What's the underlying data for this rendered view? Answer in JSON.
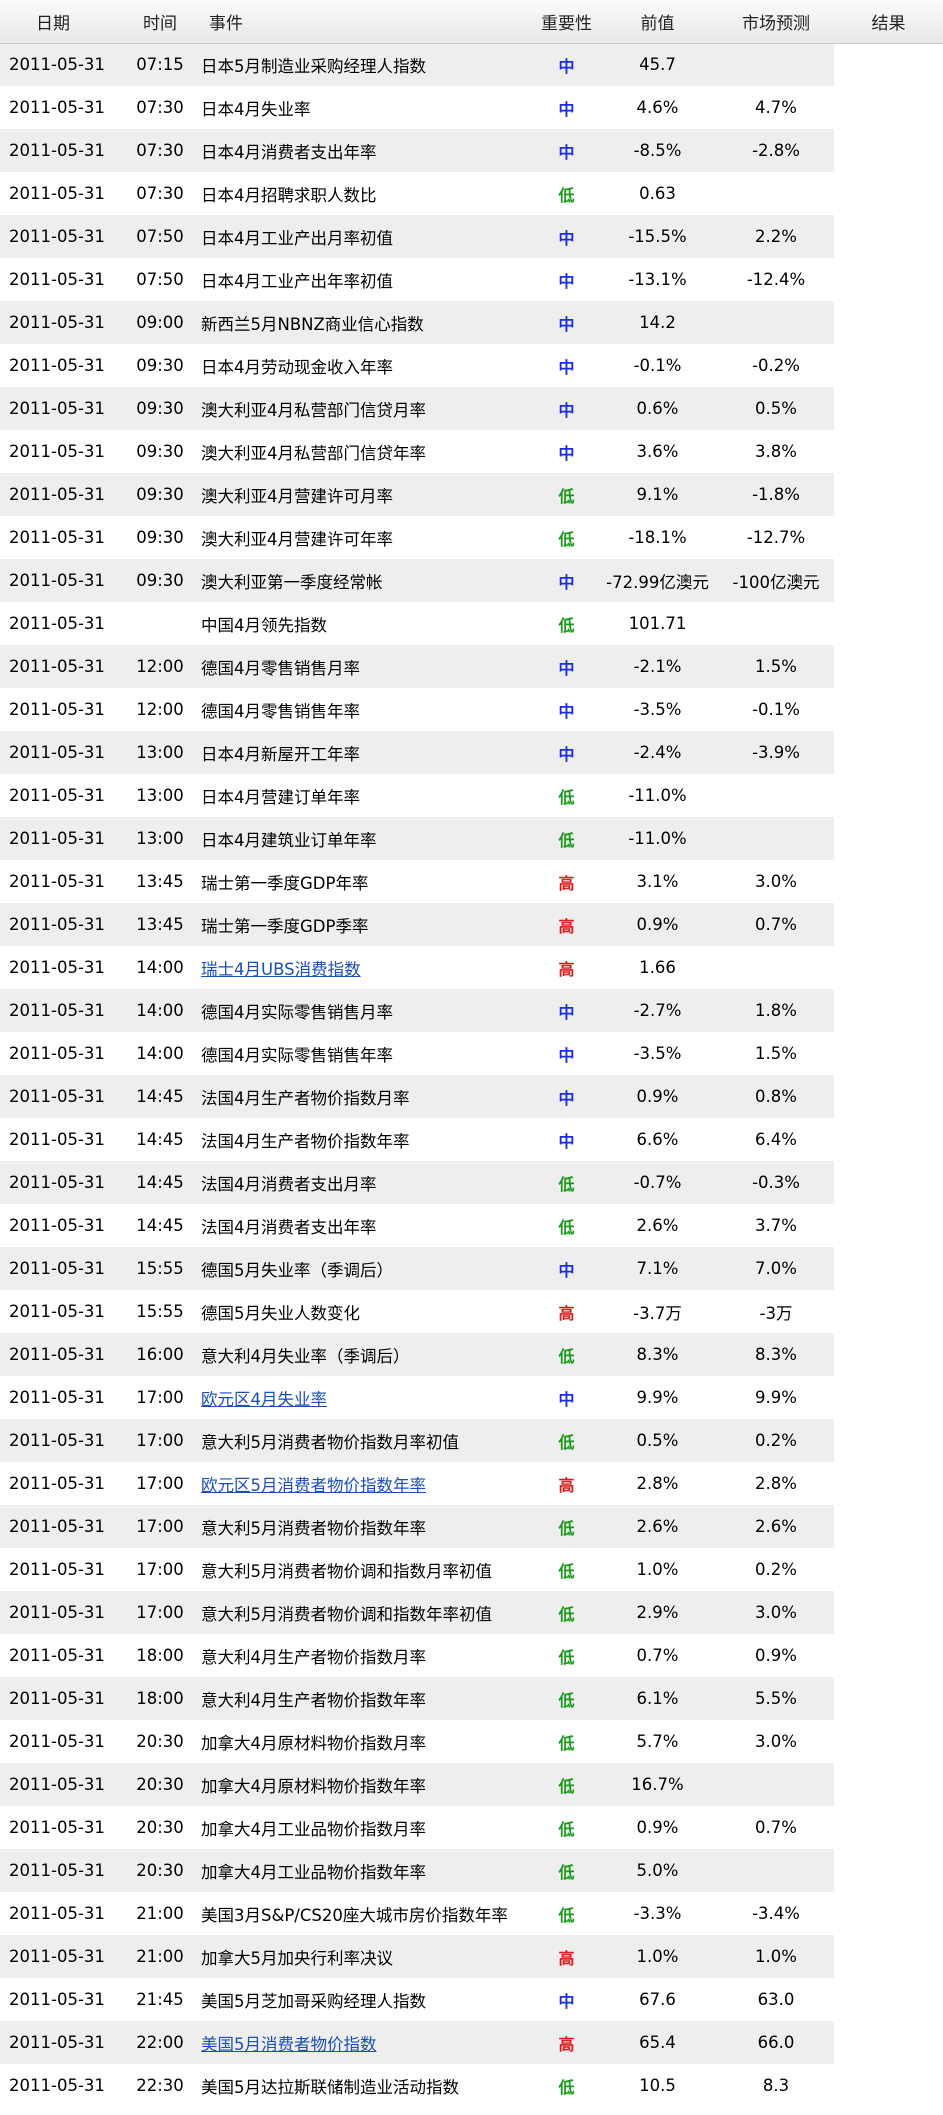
{
  "headers": {
    "date": "日期",
    "time": "时间",
    "event": "事件",
    "importance": "重要性",
    "previous": "前值",
    "forecast": "市场预测",
    "result": "结果"
  },
  "importance_colors": {
    "中": "#1a2ee0",
    "低": "#1a9a1a",
    "高": "#e01a1a"
  },
  "link_color": "#1a4fb8",
  "rows": [
    {
      "date": "2011-05-31",
      "time": "07:15",
      "event": "日本5月制造业采购经理人指数",
      "importance": "中",
      "previous": "45.7",
      "forecast": "",
      "result": "",
      "link": false
    },
    {
      "date": "2011-05-31",
      "time": "07:30",
      "event": "日本4月失业率",
      "importance": "中",
      "previous": "4.6%",
      "forecast": "4.7%",
      "result": "",
      "link": false
    },
    {
      "date": "2011-05-31",
      "time": "07:30",
      "event": "日本4月消费者支出年率",
      "importance": "中",
      "previous": "-8.5%",
      "forecast": "-2.8%",
      "result": "",
      "link": false
    },
    {
      "date": "2011-05-31",
      "time": "07:30",
      "event": "日本4月招聘求职人数比",
      "importance": "低",
      "previous": "0.63",
      "forecast": "",
      "result": "",
      "link": false
    },
    {
      "date": "2011-05-31",
      "time": "07:50",
      "event": "日本4月工业产出月率初值",
      "importance": "中",
      "previous": "-15.5%",
      "forecast": "2.2%",
      "result": "",
      "link": false
    },
    {
      "date": "2011-05-31",
      "time": "07:50",
      "event": "日本4月工业产出年率初值",
      "importance": "中",
      "previous": "-13.1%",
      "forecast": "-12.4%",
      "result": "",
      "link": false
    },
    {
      "date": "2011-05-31",
      "time": "09:00",
      "event": "新西兰5月NBNZ商业信心指数",
      "importance": "中",
      "previous": "14.2",
      "forecast": "",
      "result": "",
      "link": false
    },
    {
      "date": "2011-05-31",
      "time": "09:30",
      "event": "日本4月劳动现金收入年率",
      "importance": "中",
      "previous": "-0.1%",
      "forecast": "-0.2%",
      "result": "",
      "link": false
    },
    {
      "date": "2011-05-31",
      "time": "09:30",
      "event": "澳大利亚4月私营部门信贷月率",
      "importance": "中",
      "previous": "0.6%",
      "forecast": "0.5%",
      "result": "",
      "link": false
    },
    {
      "date": "2011-05-31",
      "time": "09:30",
      "event": "澳大利亚4月私营部门信贷年率",
      "importance": "中",
      "previous": "3.6%",
      "forecast": "3.8%",
      "result": "",
      "link": false
    },
    {
      "date": "2011-05-31",
      "time": "09:30",
      "event": "澳大利亚4月营建许可月率",
      "importance": "低",
      "previous": "9.1%",
      "forecast": "-1.8%",
      "result": "",
      "link": false
    },
    {
      "date": "2011-05-31",
      "time": "09:30",
      "event": "澳大利亚4月营建许可年率",
      "importance": "低",
      "previous": "-18.1%",
      "forecast": "-12.7%",
      "result": "",
      "link": false
    },
    {
      "date": "2011-05-31",
      "time": "09:30",
      "event": "澳大利亚第一季度经常帐",
      "importance": "中",
      "previous": "-72.99亿澳元",
      "forecast": "-100亿澳元",
      "result": "",
      "link": false
    },
    {
      "date": "2011-05-31",
      "time": "",
      "event": "中国4月领先指数",
      "importance": "低",
      "previous": "101.71",
      "forecast": "",
      "result": "",
      "link": false
    },
    {
      "date": "2011-05-31",
      "time": "12:00",
      "event": "德国4月零售销售月率",
      "importance": "中",
      "previous": "-2.1%",
      "forecast": "1.5%",
      "result": "",
      "link": false
    },
    {
      "date": "2011-05-31",
      "time": "12:00",
      "event": "德国4月零售销售年率",
      "importance": "中",
      "previous": "-3.5%",
      "forecast": "-0.1%",
      "result": "",
      "link": false
    },
    {
      "date": "2011-05-31",
      "time": "13:00",
      "event": "日本4月新屋开工年率",
      "importance": "中",
      "previous": "-2.4%",
      "forecast": "-3.9%",
      "result": "",
      "link": false
    },
    {
      "date": "2011-05-31",
      "time": "13:00",
      "event": "日本4月营建订单年率",
      "importance": "低",
      "previous": "-11.0%",
      "forecast": "",
      "result": "",
      "link": false
    },
    {
      "date": "2011-05-31",
      "time": "13:00",
      "event": "日本4月建筑业订单年率",
      "importance": "低",
      "previous": "-11.0%",
      "forecast": "",
      "result": "",
      "link": false
    },
    {
      "date": "2011-05-31",
      "time": "13:45",
      "event": "瑞士第一季度GDP年率",
      "importance": "高",
      "previous": "3.1%",
      "forecast": "3.0%",
      "result": "",
      "link": false
    },
    {
      "date": "2011-05-31",
      "time": "13:45",
      "event": "瑞士第一季度GDP季率",
      "importance": "高",
      "previous": "0.9%",
      "forecast": "0.7%",
      "result": "",
      "link": false
    },
    {
      "date": "2011-05-31",
      "time": "14:00",
      "event": "瑞士4月UBS消费指数",
      "importance": "高",
      "previous": "1.66",
      "forecast": "",
      "result": "",
      "link": true
    },
    {
      "date": "2011-05-31",
      "time": "14:00",
      "event": "德国4月实际零售销售月率",
      "importance": "中",
      "previous": "-2.7%",
      "forecast": "1.8%",
      "result": "",
      "link": false
    },
    {
      "date": "2011-05-31",
      "time": "14:00",
      "event": "德国4月实际零售销售年率",
      "importance": "中",
      "previous": "-3.5%",
      "forecast": "1.5%",
      "result": "",
      "link": false
    },
    {
      "date": "2011-05-31",
      "time": "14:45",
      "event": "法国4月生产者物价指数月率",
      "importance": "中",
      "previous": "0.9%",
      "forecast": "0.8%",
      "result": "",
      "link": false
    },
    {
      "date": "2011-05-31",
      "time": "14:45",
      "event": "法国4月生产者物价指数年率",
      "importance": "中",
      "previous": "6.6%",
      "forecast": "6.4%",
      "result": "",
      "link": false
    },
    {
      "date": "2011-05-31",
      "time": "14:45",
      "event": "法国4月消费者支出月率",
      "importance": "低",
      "previous": "-0.7%",
      "forecast": "-0.3%",
      "result": "",
      "link": false
    },
    {
      "date": "2011-05-31",
      "time": "14:45",
      "event": "法国4月消费者支出年率",
      "importance": "低",
      "previous": "2.6%",
      "forecast": "3.7%",
      "result": "",
      "link": false
    },
    {
      "date": "2011-05-31",
      "time": "15:55",
      "event": "德国5月失业率（季调后）",
      "importance": "中",
      "previous": "7.1%",
      "forecast": "7.0%",
      "result": "",
      "link": false
    },
    {
      "date": "2011-05-31",
      "time": "15:55",
      "event": "德国5月失业人数变化",
      "importance": "高",
      "previous": "-3.7万",
      "forecast": "-3万",
      "result": "",
      "link": false
    },
    {
      "date": "2011-05-31",
      "time": "16:00",
      "event": "意大利4月失业率（季调后）",
      "importance": "低",
      "previous": "8.3%",
      "forecast": "8.3%",
      "result": "",
      "link": false
    },
    {
      "date": "2011-05-31",
      "time": "17:00",
      "event": "欧元区4月失业率",
      "importance": "中",
      "previous": "9.9%",
      "forecast": "9.9%",
      "result": "",
      "link": true
    },
    {
      "date": "2011-05-31",
      "time": "17:00",
      "event": "意大利5月消费者物价指数月率初值",
      "importance": "低",
      "previous": "0.5%",
      "forecast": "0.2%",
      "result": "",
      "link": false
    },
    {
      "date": "2011-05-31",
      "time": "17:00",
      "event": "欧元区5月消费者物价指数年率",
      "importance": "高",
      "previous": "2.8%",
      "forecast": "2.8%",
      "result": "",
      "link": true
    },
    {
      "date": "2011-05-31",
      "time": "17:00",
      "event": "意大利5月消费者物价指数年率",
      "importance": "低",
      "previous": "2.6%",
      "forecast": "2.6%",
      "result": "",
      "link": false
    },
    {
      "date": "2011-05-31",
      "time": "17:00",
      "event": "意大利5月消费者物价调和指数月率初值",
      "importance": "低",
      "previous": "1.0%",
      "forecast": "0.2%",
      "result": "",
      "link": false
    },
    {
      "date": "2011-05-31",
      "time": "17:00",
      "event": "意大利5月消费者物价调和指数年率初值",
      "importance": "低",
      "previous": "2.9%",
      "forecast": "3.0%",
      "result": "",
      "link": false
    },
    {
      "date": "2011-05-31",
      "time": "18:00",
      "event": "意大利4月生产者物价指数月率",
      "importance": "低",
      "previous": "0.7%",
      "forecast": "0.9%",
      "result": "",
      "link": false
    },
    {
      "date": "2011-05-31",
      "time": "18:00",
      "event": "意大利4月生产者物价指数年率",
      "importance": "低",
      "previous": "6.1%",
      "forecast": "5.5%",
      "result": "",
      "link": false
    },
    {
      "date": "2011-05-31",
      "time": "20:30",
      "event": "加拿大4月原材料物价指数月率",
      "importance": "低",
      "previous": "5.7%",
      "forecast": "3.0%",
      "result": "",
      "link": false
    },
    {
      "date": "2011-05-31",
      "time": "20:30",
      "event": "加拿大4月原材料物价指数年率",
      "importance": "低",
      "previous": "16.7%",
      "forecast": "",
      "result": "",
      "link": false
    },
    {
      "date": "2011-05-31",
      "time": "20:30",
      "event": "加拿大4月工业品物价指数月率",
      "importance": "低",
      "previous": "0.9%",
      "forecast": "0.7%",
      "result": "",
      "link": false
    },
    {
      "date": "2011-05-31",
      "time": "20:30",
      "event": "加拿大4月工业品物价指数年率",
      "importance": "低",
      "previous": "5.0%",
      "forecast": "",
      "result": "",
      "link": false
    },
    {
      "date": "2011-05-31",
      "time": "21:00",
      "event": "美国3月S&P/CS20座大城市房价指数年率",
      "importance": "低",
      "previous": "-3.3%",
      "forecast": "-3.4%",
      "result": "",
      "link": false
    },
    {
      "date": "2011-05-31",
      "time": "21:00",
      "event": "加拿大5月加央行利率决议",
      "importance": "高",
      "previous": "1.0%",
      "forecast": "1.0%",
      "result": "",
      "link": false
    },
    {
      "date": "2011-05-31",
      "time": "21:45",
      "event": "美国5月芝加哥采购经理人指数",
      "importance": "中",
      "previous": "67.6",
      "forecast": "63.0",
      "result": "",
      "link": false
    },
    {
      "date": "2011-05-31",
      "time": "22:00",
      "event": "美国5月消费者物价指数",
      "importance": "高",
      "previous": "65.4",
      "forecast": "66.0",
      "result": "",
      "link": true
    },
    {
      "date": "2011-05-31",
      "time": "22:30",
      "event": "美国5月达拉斯联储制造业活动指数",
      "importance": "低",
      "previous": "10.5",
      "forecast": "8.3",
      "result": "",
      "link": false
    }
  ]
}
